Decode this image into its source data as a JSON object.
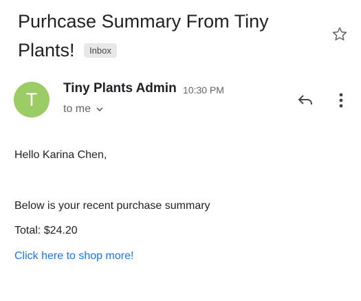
{
  "email": {
    "subject": "Purhcase Summary From Tiny Plants!",
    "label": "Inbox",
    "sender": {
      "name": "Tiny Plants Admin",
      "initial": "T",
      "avatar_color": "#9ccc65",
      "time": "10:30 PM",
      "recipient": "to me"
    },
    "body": {
      "greeting": "Hello Karina Chen,",
      "intro": "Below is your recent purchase summary",
      "total": "Total: $24.20",
      "link": "Click here to shop more!"
    }
  },
  "icons": {
    "star": "star-icon",
    "reply": "reply-icon",
    "more": "more-vert-icon",
    "recipient_toggle": "chevron-down-icon"
  },
  "colors": {
    "link": "#1a73e8",
    "secondary_text": "#5f6368"
  }
}
